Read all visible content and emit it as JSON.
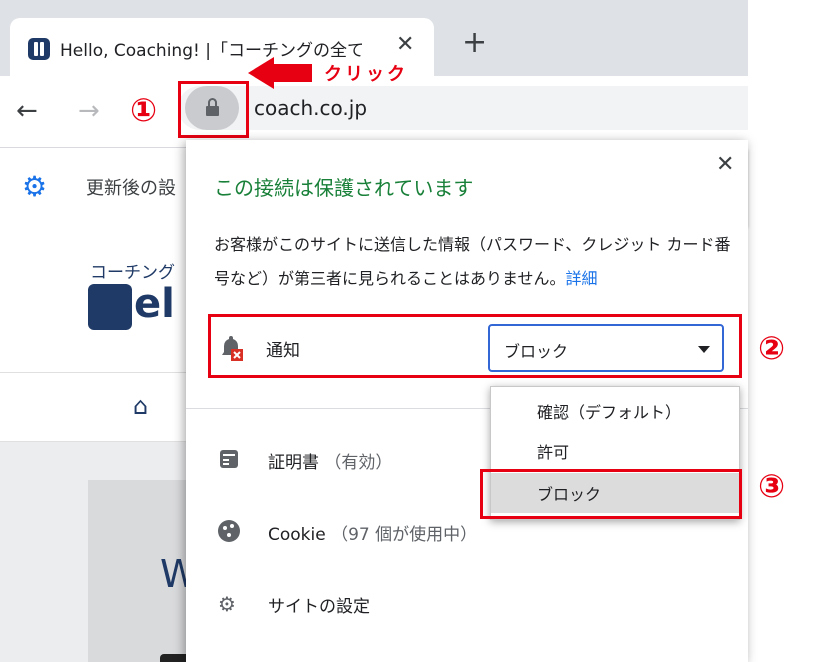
{
  "browser": {
    "tab_title": "Hello, Coaching! |「コーチングの全て",
    "tab_close": "✕",
    "new_tab": "+",
    "back": "←",
    "forward": "→",
    "url": "coach.co.jp"
  },
  "bookmarks": {
    "item_text": "更新後の設"
  },
  "page_behind": {
    "subtitle": "コーチング",
    "logo_text": "el",
    "home_icon": "⌂",
    "hero_letter": "W"
  },
  "popup": {
    "close": "✕",
    "title": "この接続は保護されています",
    "description": "お客様がこのサイトに送信した情報（パスワード、クレジット カード番号など）が第三者に見られることはありません。",
    "details_link": "詳細",
    "notification_label": "通知",
    "notification_value": "ブロック",
    "certificate_label": "証明書",
    "certificate_status": "（有効）",
    "cookie_label": "Cookie",
    "cookie_status": "（97 個が使用中）",
    "site_settings_label": "サイトの設定"
  },
  "dropdown": {
    "options": [
      "確認（デフォルト）",
      "許可",
      "ブロック"
    ],
    "selected": "ブロック"
  },
  "annotations": {
    "step1": "①",
    "step2": "②",
    "step3": "③",
    "click_text": "クリック",
    "accent_color": "#e60012"
  },
  "icons": [
    "lock-icon",
    "gear-icon",
    "bell-blocked-icon",
    "certificate-icon",
    "cookie-icon",
    "settings-gear-icon",
    "dropdown-arrow-icon",
    "home-icon"
  ]
}
